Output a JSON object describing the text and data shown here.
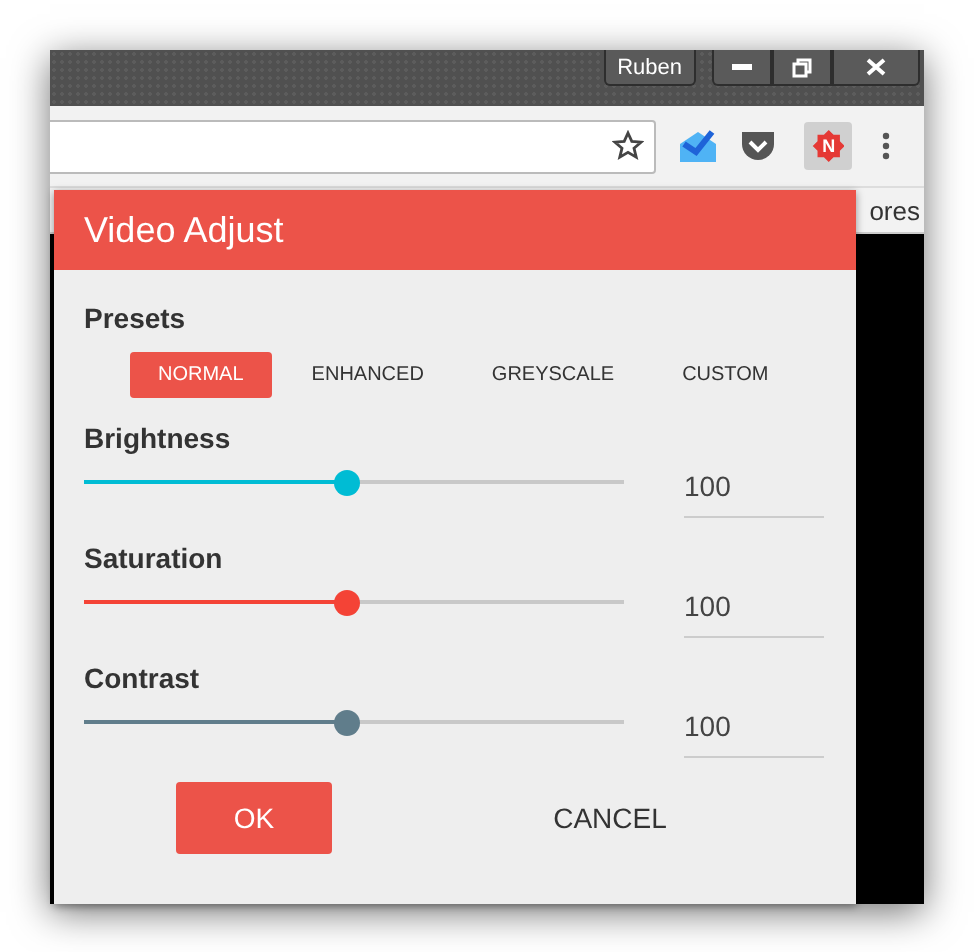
{
  "window": {
    "profile": "Ruben"
  },
  "toolbar": {
    "extension_badge": "N",
    "extension_active": true
  },
  "bookmark_bar": {
    "text": "ores"
  },
  "popup": {
    "title": "Video Adjust",
    "presets_label": "Presets",
    "presets": [
      {
        "label": "NORMAL",
        "selected": true
      },
      {
        "label": "ENHANCED",
        "selected": false
      },
      {
        "label": "GREYSCALE",
        "selected": false
      },
      {
        "label": "CUSTOM",
        "selected": false
      }
    ],
    "sliders": [
      {
        "name": "Brightness",
        "level": 0.485,
        "value": "100",
        "color": "#00bcd4"
      },
      {
        "name": "Saturation",
        "level": 0.485,
        "value": "100",
        "color": "#f44336"
      },
      {
        "name": "Contrast",
        "level": 0.485,
        "value": "100",
        "color": "#607d8b"
      }
    ],
    "buttons": [
      {
        "label": "OK",
        "kind": "primary"
      },
      {
        "label": "CANCEL",
        "kind": "flat"
      }
    ]
  }
}
